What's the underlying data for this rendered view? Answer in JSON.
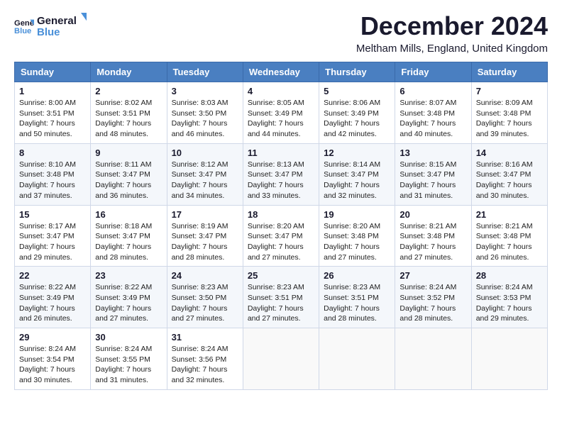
{
  "logo": {
    "line1": "General",
    "line2": "Blue"
  },
  "title": "December 2024",
  "location": "Meltham Mills, England, United Kingdom",
  "days_of_week": [
    "Sunday",
    "Monday",
    "Tuesday",
    "Wednesday",
    "Thursday",
    "Friday",
    "Saturday"
  ],
  "weeks": [
    [
      {
        "day": "1",
        "sunrise": "Sunrise: 8:00 AM",
        "sunset": "Sunset: 3:51 PM",
        "daylight": "Daylight: 7 hours and 50 minutes."
      },
      {
        "day": "2",
        "sunrise": "Sunrise: 8:02 AM",
        "sunset": "Sunset: 3:51 PM",
        "daylight": "Daylight: 7 hours and 48 minutes."
      },
      {
        "day": "3",
        "sunrise": "Sunrise: 8:03 AM",
        "sunset": "Sunset: 3:50 PM",
        "daylight": "Daylight: 7 hours and 46 minutes."
      },
      {
        "day": "4",
        "sunrise": "Sunrise: 8:05 AM",
        "sunset": "Sunset: 3:49 PM",
        "daylight": "Daylight: 7 hours and 44 minutes."
      },
      {
        "day": "5",
        "sunrise": "Sunrise: 8:06 AM",
        "sunset": "Sunset: 3:49 PM",
        "daylight": "Daylight: 7 hours and 42 minutes."
      },
      {
        "day": "6",
        "sunrise": "Sunrise: 8:07 AM",
        "sunset": "Sunset: 3:48 PM",
        "daylight": "Daylight: 7 hours and 40 minutes."
      },
      {
        "day": "7",
        "sunrise": "Sunrise: 8:09 AM",
        "sunset": "Sunset: 3:48 PM",
        "daylight": "Daylight: 7 hours and 39 minutes."
      }
    ],
    [
      {
        "day": "8",
        "sunrise": "Sunrise: 8:10 AM",
        "sunset": "Sunset: 3:48 PM",
        "daylight": "Daylight: 7 hours and 37 minutes."
      },
      {
        "day": "9",
        "sunrise": "Sunrise: 8:11 AM",
        "sunset": "Sunset: 3:47 PM",
        "daylight": "Daylight: 7 hours and 36 minutes."
      },
      {
        "day": "10",
        "sunrise": "Sunrise: 8:12 AM",
        "sunset": "Sunset: 3:47 PM",
        "daylight": "Daylight: 7 hours and 34 minutes."
      },
      {
        "day": "11",
        "sunrise": "Sunrise: 8:13 AM",
        "sunset": "Sunset: 3:47 PM",
        "daylight": "Daylight: 7 hours and 33 minutes."
      },
      {
        "day": "12",
        "sunrise": "Sunrise: 8:14 AM",
        "sunset": "Sunset: 3:47 PM",
        "daylight": "Daylight: 7 hours and 32 minutes."
      },
      {
        "day": "13",
        "sunrise": "Sunrise: 8:15 AM",
        "sunset": "Sunset: 3:47 PM",
        "daylight": "Daylight: 7 hours and 31 minutes."
      },
      {
        "day": "14",
        "sunrise": "Sunrise: 8:16 AM",
        "sunset": "Sunset: 3:47 PM",
        "daylight": "Daylight: 7 hours and 30 minutes."
      }
    ],
    [
      {
        "day": "15",
        "sunrise": "Sunrise: 8:17 AM",
        "sunset": "Sunset: 3:47 PM",
        "daylight": "Daylight: 7 hours and 29 minutes."
      },
      {
        "day": "16",
        "sunrise": "Sunrise: 8:18 AM",
        "sunset": "Sunset: 3:47 PM",
        "daylight": "Daylight: 7 hours and 28 minutes."
      },
      {
        "day": "17",
        "sunrise": "Sunrise: 8:19 AM",
        "sunset": "Sunset: 3:47 PM",
        "daylight": "Daylight: 7 hours and 28 minutes."
      },
      {
        "day": "18",
        "sunrise": "Sunrise: 8:20 AM",
        "sunset": "Sunset: 3:47 PM",
        "daylight": "Daylight: 7 hours and 27 minutes."
      },
      {
        "day": "19",
        "sunrise": "Sunrise: 8:20 AM",
        "sunset": "Sunset: 3:48 PM",
        "daylight": "Daylight: 7 hours and 27 minutes."
      },
      {
        "day": "20",
        "sunrise": "Sunrise: 8:21 AM",
        "sunset": "Sunset: 3:48 PM",
        "daylight": "Daylight: 7 hours and 27 minutes."
      },
      {
        "day": "21",
        "sunrise": "Sunrise: 8:21 AM",
        "sunset": "Sunset: 3:48 PM",
        "daylight": "Daylight: 7 hours and 26 minutes."
      }
    ],
    [
      {
        "day": "22",
        "sunrise": "Sunrise: 8:22 AM",
        "sunset": "Sunset: 3:49 PM",
        "daylight": "Daylight: 7 hours and 26 minutes."
      },
      {
        "day": "23",
        "sunrise": "Sunrise: 8:22 AM",
        "sunset": "Sunset: 3:49 PM",
        "daylight": "Daylight: 7 hours and 27 minutes."
      },
      {
        "day": "24",
        "sunrise": "Sunrise: 8:23 AM",
        "sunset": "Sunset: 3:50 PM",
        "daylight": "Daylight: 7 hours and 27 minutes."
      },
      {
        "day": "25",
        "sunrise": "Sunrise: 8:23 AM",
        "sunset": "Sunset: 3:51 PM",
        "daylight": "Daylight: 7 hours and 27 minutes."
      },
      {
        "day": "26",
        "sunrise": "Sunrise: 8:23 AM",
        "sunset": "Sunset: 3:51 PM",
        "daylight": "Daylight: 7 hours and 28 minutes."
      },
      {
        "day": "27",
        "sunrise": "Sunrise: 8:24 AM",
        "sunset": "Sunset: 3:52 PM",
        "daylight": "Daylight: 7 hours and 28 minutes."
      },
      {
        "day": "28",
        "sunrise": "Sunrise: 8:24 AM",
        "sunset": "Sunset: 3:53 PM",
        "daylight": "Daylight: 7 hours and 29 minutes."
      }
    ],
    [
      {
        "day": "29",
        "sunrise": "Sunrise: 8:24 AM",
        "sunset": "Sunset: 3:54 PM",
        "daylight": "Daylight: 7 hours and 30 minutes."
      },
      {
        "day": "30",
        "sunrise": "Sunrise: 8:24 AM",
        "sunset": "Sunset: 3:55 PM",
        "daylight": "Daylight: 7 hours and 31 minutes."
      },
      {
        "day": "31",
        "sunrise": "Sunrise: 8:24 AM",
        "sunset": "Sunset: 3:56 PM",
        "daylight": "Daylight: 7 hours and 32 minutes."
      },
      null,
      null,
      null,
      null
    ]
  ]
}
